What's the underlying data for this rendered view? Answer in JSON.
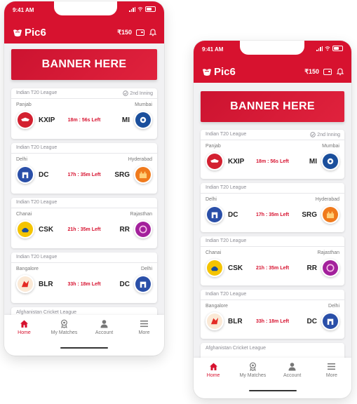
{
  "status_bar": {
    "time": "9:41 AM"
  },
  "app": {
    "name": "Pic6",
    "balance": "₹150"
  },
  "banner": {
    "text": "BANNER HERE"
  },
  "matches": [
    {
      "league": "Indian T20 League",
      "inning": "2nd Inning",
      "home_city": "Panjab",
      "home_code": "KXIP",
      "away_city": "Mumbai",
      "away_code": "MI",
      "time_left": "18m : 56s Left",
      "home_color": "#d32030",
      "away_color": "#1b4f9c"
    },
    {
      "league": "Indian T20 League",
      "home_city": "Delhi",
      "home_code": "DC",
      "away_city": "Hyderabad",
      "away_code": "SRG",
      "time_left": "17h : 35m Left",
      "home_color": "#2a4fa8",
      "away_color": "#f07a1c"
    },
    {
      "league": "Indian T20 League",
      "home_city": "Chanai",
      "home_code": "CSK",
      "away_city": "Rajasthan",
      "away_code": "RR",
      "time_left": "21h : 35m Left",
      "home_color": "#f4c400",
      "away_color": "#a3219c"
    },
    {
      "league": "Indian T20 League",
      "home_city": "Bangalore",
      "home_code": "BLR",
      "away_city": "Delhi",
      "away_code": "DC",
      "time_left": "33h : 18m Left",
      "home_color": "#e42a24",
      "away_color": "#2a4fa8"
    }
  ],
  "next_league": "Afghanistan Cricket League",
  "nav": [
    {
      "label": "Home",
      "icon": "home-icon",
      "active": true
    },
    {
      "label": "My Matches",
      "icon": "medal-icon",
      "active": false
    },
    {
      "label": "Account",
      "icon": "user-icon",
      "active": false
    },
    {
      "label": "More",
      "icon": "menu-icon",
      "active": false
    }
  ],
  "colors": {
    "brand": "#d7122f",
    "background": "#f1f1f3"
  }
}
